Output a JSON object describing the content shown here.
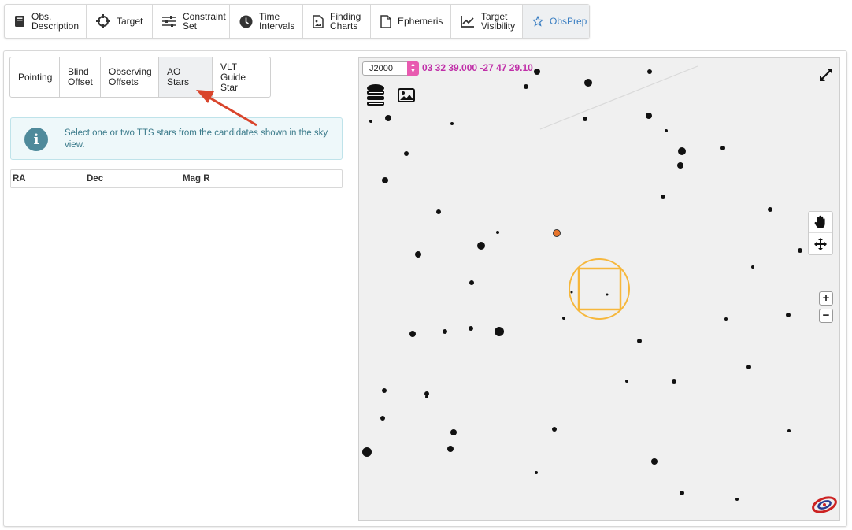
{
  "top_tabs": [
    {
      "label_line1": "Obs.",
      "label_line2": "Description",
      "icon": "book-icon"
    },
    {
      "label_line1": "Target",
      "label_line2": "",
      "icon": "crosshair-icon"
    },
    {
      "label_line1": "Constraint",
      "label_line2": "Set",
      "icon": "sliders-icon"
    },
    {
      "label_line1": "Time",
      "label_line2": "Intervals",
      "icon": "clock-icon"
    },
    {
      "label_line1": "Finding",
      "label_line2": "Charts",
      "icon": "image-file-icon"
    },
    {
      "label_line1": "Ephemeris",
      "label_line2": "",
      "icon": "file-icon"
    },
    {
      "label_line1": "Target",
      "label_line2": "Visibility",
      "icon": "line-chart-icon"
    },
    {
      "label_line1": "ObsPrep",
      "label_line2": "",
      "icon": "star-icon"
    }
  ],
  "active_top_tab": "ObsPrep",
  "sub_tabs": [
    {
      "line1": "Pointing",
      "line2": ""
    },
    {
      "line1": "Blind",
      "line2": "Offset"
    },
    {
      "line1": "Observing",
      "line2": "Offsets"
    },
    {
      "line1": "AO Stars",
      "line2": ""
    },
    {
      "line1": "VLT Guide",
      "line2": "Star"
    }
  ],
  "active_sub_tab": "AO Stars",
  "info": {
    "message": "Select one or two TTS stars from the candidates shown in the sky view."
  },
  "table": {
    "columns": [
      "RA",
      "Dec",
      "Mag R"
    ]
  },
  "sky_view": {
    "frame": "J2000",
    "coordinates": "03 32 39.000 -27 47 29.10",
    "accent_color": "#c02fa8",
    "target_marker_color": "#f6b73c",
    "candidate_color": "#e8742b"
  },
  "colors": {
    "active_tab_text": "#3a7ec2",
    "arrow": "#d9452c",
    "info_bg": "#eef8fa"
  }
}
